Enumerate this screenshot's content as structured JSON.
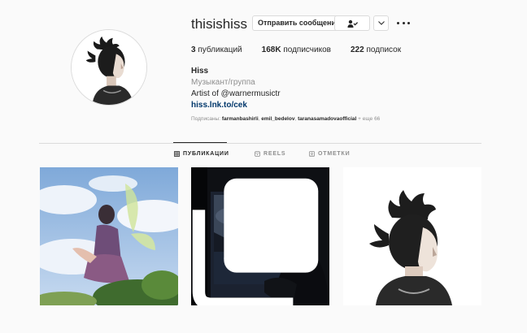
{
  "profile": {
    "username": "thisishiss",
    "avatar_icon": "profile-photo",
    "message_button": "Отправить сообщение",
    "following_icon": "person-check-icon",
    "dropdown_icon": "chevron-down-icon",
    "more_icon": "more-horizontal-icon"
  },
  "stats": {
    "posts_count": "3",
    "posts_label": "публикаций",
    "followers_count": "168K",
    "followers_label": "подписчиков",
    "following_count": "222",
    "following_label": "подписок"
  },
  "bio": {
    "name": "Hiss",
    "category": "Музыкант/группа",
    "text": "Artist of @warnermusictr",
    "link": "hiss.lnk.to/cek"
  },
  "followed_by": {
    "prefix": "Подписаны:",
    "user1": "farmanbashirli",
    "user2": "emil_bedelov",
    "user3": "taranasamadovaofficial",
    "suffix": "+ еще 66"
  },
  "tabs": [
    {
      "label": "ПУБЛИКАЦИИ",
      "icon": "grid-icon",
      "active": true
    },
    {
      "label": "REELS",
      "icon": "reels-icon",
      "active": false
    },
    {
      "label": "ОТМЕТКИ",
      "icon": "tagged-icon",
      "active": false
    }
  ],
  "posts": [
    {
      "kind": "photo",
      "description_icon": "fairy-photo"
    },
    {
      "kind": "multi-photo",
      "description_icon": "night-window-photo",
      "badge_icon": "carousel-icon"
    },
    {
      "kind": "photo",
      "description_icon": "portrait-photo"
    }
  ],
  "colors": {
    "text": "#262626",
    "muted": "#8e8e8e",
    "link": "#00376b",
    "border": "#dbdbdb",
    "background": "#fafafa"
  }
}
